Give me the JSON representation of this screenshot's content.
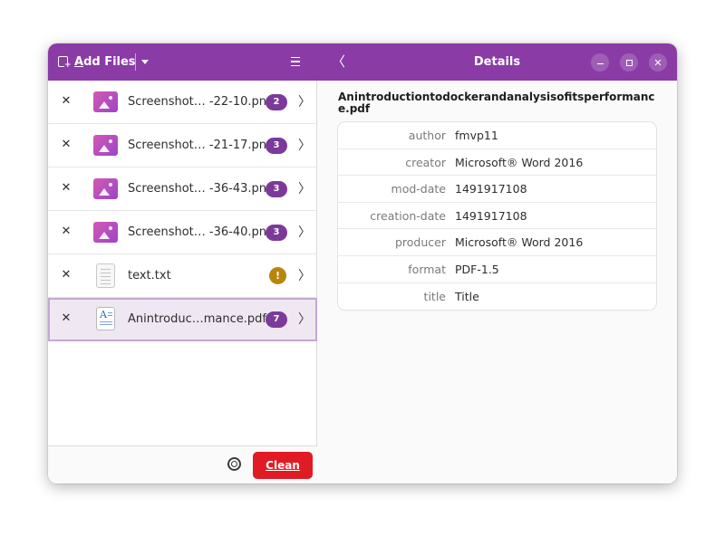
{
  "toolbar": {
    "add_files_prefix": "A",
    "add_files_rest": "dd Files"
  },
  "files": [
    {
      "name": "Screenshot… -22-10.png",
      "badge": "2",
      "icon": "image-icon"
    },
    {
      "name": "Screenshot… -21-17.png",
      "badge": "3",
      "icon": "image-icon"
    },
    {
      "name": "Screenshot… -36-43.png",
      "badge": "3",
      "icon": "image-icon"
    },
    {
      "name": "Screenshot… -36-40.png",
      "badge": "3",
      "icon": "image-icon"
    },
    {
      "name": "text.txt",
      "badge": "!",
      "icon": "text-file-icon"
    },
    {
      "name": "Anintroduc…mance.pdf",
      "badge": "7",
      "icon": "pdf-file-icon"
    }
  ],
  "selected_index": 5,
  "footer": {
    "clean_prefix": "C",
    "clean_rest": "lean"
  },
  "details": {
    "title": "Details",
    "doc_title": "Anintroductiontodockerandanalysisofitsperformance.pdf",
    "metadata": [
      {
        "key": "author",
        "value": "fmvp11"
      },
      {
        "key": "creator",
        "value": "Microsoft® Word 2016"
      },
      {
        "key": "mod-date",
        "value": "1491917108"
      },
      {
        "key": "creation-date",
        "value": "1491917108"
      },
      {
        "key": "producer",
        "value": "Microsoft® Word 2016"
      },
      {
        "key": "format",
        "value": "PDF-1.5"
      },
      {
        "key": "title",
        "value": "Title"
      }
    ]
  },
  "colors": {
    "header": "#8a3ba6",
    "badge": "#7b3a99",
    "warning": "#b8860b",
    "clean_button": "#e01b24"
  }
}
